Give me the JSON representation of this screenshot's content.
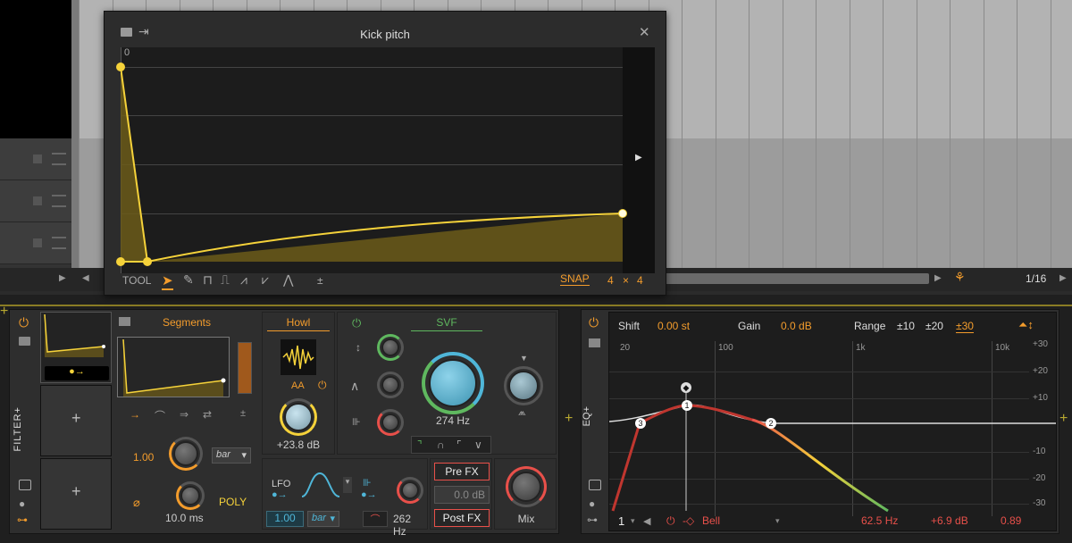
{
  "popup": {
    "title": "Kick pitch",
    "ruler_zero": "0",
    "tool_label": "TOOL",
    "bipolar_label": "±",
    "snap_label": "SNAP",
    "snap_a": "4",
    "snap_x": "×",
    "snap_b": "4"
  },
  "arrangement": {
    "zoom": "1/16"
  },
  "filter_device": {
    "name": "FILTER+",
    "segments_title": "Segments",
    "segments_rate": "1.00",
    "segments_mode": "bar",
    "segments_time": "10.0 ms",
    "segments_poly": "POLY",
    "howl_title": "Howl",
    "howl_aa": "AA",
    "howl_gain": "+23.8 dB",
    "svf_title": "SVF",
    "svf_freq": "274 Hz",
    "lfo_label": "LFO",
    "lfo_rate": "1.00",
    "lfo_mode": "bar",
    "mod_freq": "262 Hz",
    "pre_fx": "Pre FX",
    "fx_gain": "0.0 dB",
    "post_fx": "Post FX",
    "mix": "Mix"
  },
  "eq_device": {
    "name": "EQ+",
    "shift_label": "Shift",
    "shift_value": "0.00 st",
    "gain_label": "Gain",
    "gain_value": "0.0 dB",
    "range_label": "Range",
    "range_10": "±10",
    "range_20": "±20",
    "range_30": "±30",
    "freq_labels": [
      "20",
      "100",
      "1k",
      "10k"
    ],
    "db_labels": [
      "+30",
      "+20",
      "+10",
      "-10",
      "-20",
      "-30"
    ],
    "band_number": "1",
    "band_type": "Bell",
    "band_freq": "62.5 Hz",
    "band_gain": "+6.9 dB",
    "band_q": "0.89",
    "nodes": [
      "1",
      "2",
      "3"
    ]
  },
  "colors": {
    "accent": "#f39c2c",
    "envelope": "#f5d23a",
    "svf_green": "#5fb85f",
    "knob_blue": "#4fb6d8",
    "eq_red": "#e8504a"
  }
}
